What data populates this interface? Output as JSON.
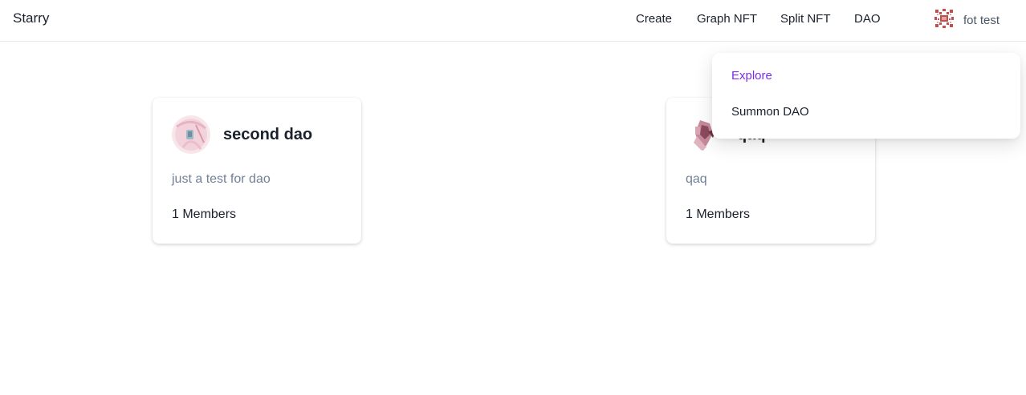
{
  "header": {
    "brand": "Starry",
    "nav": {
      "create": "Create",
      "graph_nft": "Graph NFT",
      "split_nft": "Split NFT",
      "dao": "DAO"
    },
    "user_name": "fot test"
  },
  "dao_menu": {
    "explore": "Explore",
    "summon": "Summon DAO",
    "active_color": "#7b2cf0"
  },
  "cards": [
    {
      "name": "second dao",
      "description": "just a test for dao",
      "members": "1 Members"
    },
    {
      "name": "qaq",
      "description": "qaq",
      "members": "1 Members"
    }
  ]
}
